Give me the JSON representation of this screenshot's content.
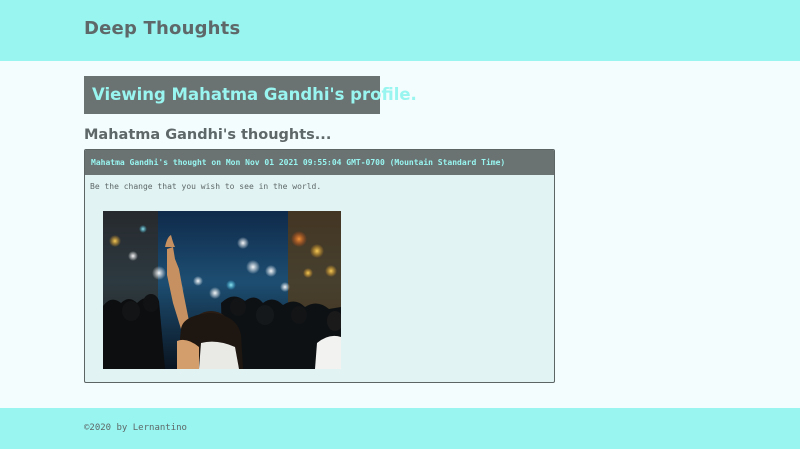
{
  "header": {
    "site_title": "Deep Thoughts"
  },
  "profile": {
    "banner": "Viewing Mahatma Gandhi's profile.",
    "thoughts_heading": "Mahatma Gandhi's thoughts..."
  },
  "thoughts": [
    {
      "header": "Mahatma Gandhi's thought on Mon Nov 01 2021 09:55:04 GMT-0700 (Mountain Standard Time)",
      "text": "Be the change that you wish to see in the world.",
      "image_name": "protest-crowd-photo"
    }
  ],
  "footer": {
    "copyright": "©2020 by Lernantino"
  },
  "colors": {
    "header_bg": "#98f5f0",
    "page_bg": "#f3fdfd",
    "banner_bg": "#6a7272",
    "banner_text": "#98f5f0",
    "card_bg": "#e1f3f3",
    "text": "#5f6868"
  }
}
